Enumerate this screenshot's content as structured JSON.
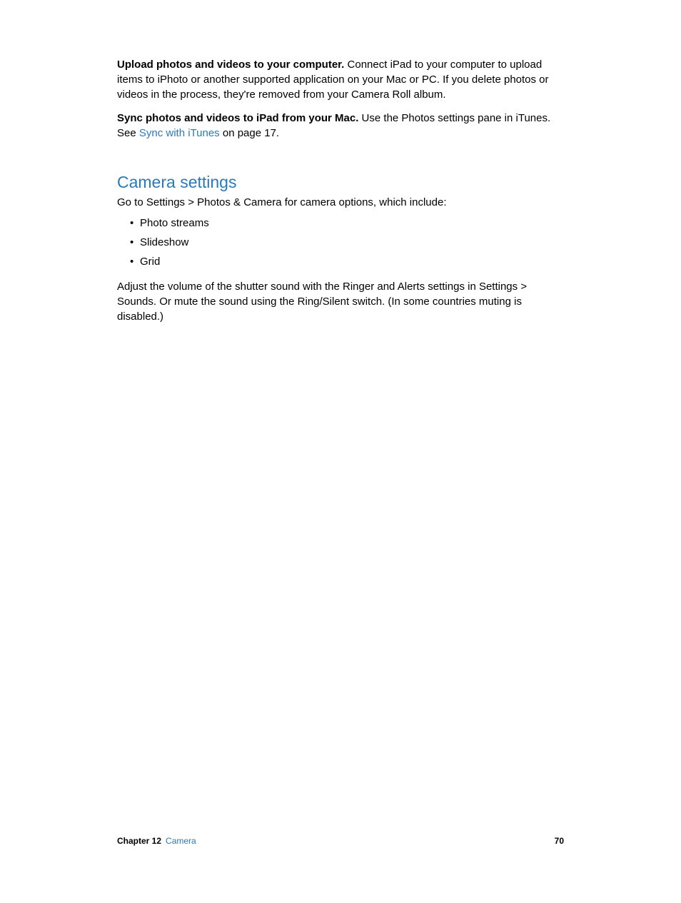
{
  "body": {
    "para1": {
      "bold": "Upload photos and videos to your computer.",
      "text": " Connect iPad to your computer to upload items to iPhoto or another supported application on your Mac or PC. If you delete photos or videos in the process, they're removed from your Camera Roll album."
    },
    "para2": {
      "bold": "Sync photos and videos to iPad from your Mac.",
      "text_before_link": " Use the Photos settings pane in iTunes. See ",
      "link": "Sync with iTunes",
      "text_after_link": " on page 17."
    },
    "section_heading": "Camera settings",
    "para3": "Go to Settings > Photos & Camera for camera options, which include:",
    "bullets": [
      "Photo streams",
      "Slideshow",
      "Grid"
    ],
    "para4": "Adjust the volume of the shutter sound with the Ringer and Alerts settings in Settings > Sounds. Or mute the sound using the Ring/Silent switch. (In some countries muting is disabled.)"
  },
  "footer": {
    "chapter_label": "Chapter  12",
    "chapter_title": "Camera",
    "page_number": "70"
  }
}
